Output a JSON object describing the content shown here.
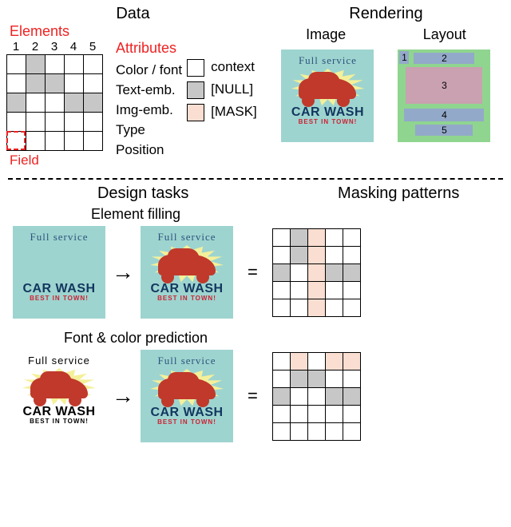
{
  "titles": {
    "data": "Data",
    "rendering": "Rendering",
    "design_tasks": "Design tasks",
    "masking_patterns": "Masking patterns"
  },
  "data_section": {
    "elements_label": "Elements",
    "attributes_label": "Attributes",
    "field_label": "Field",
    "columns": [
      "1",
      "2",
      "3",
      "4",
      "5"
    ],
    "attributes": [
      "Color / font",
      "Text-emb.",
      "Img-emb.",
      "Type",
      "Position"
    ],
    "field_cell": {
      "row": 4,
      "col": 0
    },
    "top_grid": [
      [
        "c",
        "n",
        "c",
        "c",
        "c"
      ],
      [
        "c",
        "n",
        "n",
        "c",
        "c"
      ],
      [
        "n",
        "c",
        "c",
        "n",
        "n"
      ],
      [
        "c",
        "c",
        "c",
        "c",
        "c"
      ],
      [
        "c",
        "c",
        "c",
        "c",
        "c"
      ]
    ]
  },
  "legend": {
    "context": "context",
    "null": "[NULL]",
    "mask": "[MASK]"
  },
  "rendering": {
    "image_label": "Image",
    "layout_label": "Layout",
    "layout_numbers": [
      "1",
      "2",
      "3",
      "4",
      "5"
    ]
  },
  "poster": {
    "full_service": "Full service",
    "car_wash": "CAR WASH",
    "best": "BEST IN TOWN!"
  },
  "tasks": {
    "element_filling": {
      "title": "Element filling",
      "grid": [
        [
          "c",
          "n",
          "m",
          "c",
          "c"
        ],
        [
          "c",
          "n",
          "m",
          "c",
          "c"
        ],
        [
          "n",
          "c",
          "m",
          "n",
          "n"
        ],
        [
          "c",
          "c",
          "m",
          "c",
          "c"
        ],
        [
          "c",
          "c",
          "m",
          "c",
          "c"
        ]
      ]
    },
    "font_color": {
      "title": "Font & color prediction",
      "grid": [
        [
          "c",
          "m",
          "c",
          "m",
          "m"
        ],
        [
          "c",
          "n",
          "n",
          "c",
          "c"
        ],
        [
          "n",
          "c",
          "c",
          "n",
          "n"
        ],
        [
          "c",
          "c",
          "c",
          "c",
          "c"
        ],
        [
          "c",
          "c",
          "c",
          "c",
          "c"
        ]
      ]
    }
  },
  "symbols": {
    "arrow": "→",
    "equals": "="
  }
}
